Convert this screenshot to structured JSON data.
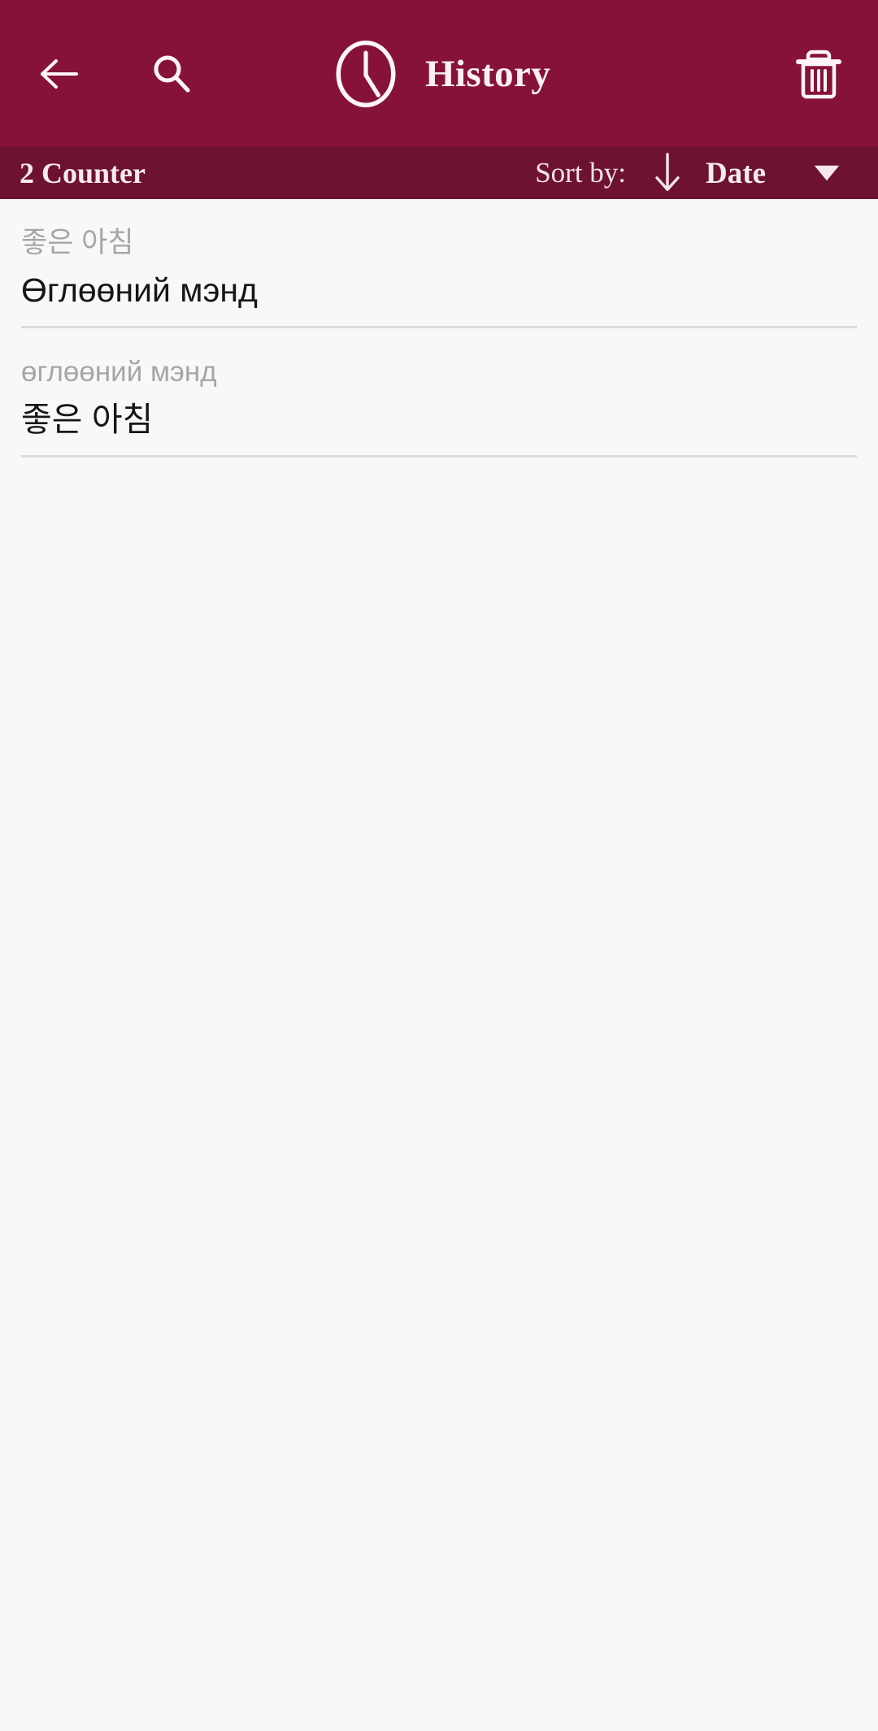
{
  "appbar": {
    "background_color": "#861337",
    "title": "History",
    "back_icon": "arrow-left-icon",
    "search_icon": "search-icon",
    "clock_icon": "clock-icon",
    "delete_icon": "trash-icon"
  },
  "sortbar": {
    "background_color": "#6e1231",
    "counter_label": "2 Counter",
    "sort_by_label": "Sort by:",
    "sort_direction_icon": "arrow-down-icon",
    "sort_value": "Date",
    "dropdown_icon": "caret-down-icon"
  },
  "list": {
    "items": [
      {
        "source_text": "좋은 아침",
        "result_text": "Өглөөний мэнд"
      },
      {
        "source_text": "өглөөний мэнд",
        "result_text": "좋은 아침"
      }
    ]
  },
  "colors": {
    "page_background": "#f8f8f9",
    "source_text": "#a6a6a6",
    "result_text": "#161616",
    "divider": "#dcdcdc",
    "on_primary_text": "#f6eaee"
  }
}
